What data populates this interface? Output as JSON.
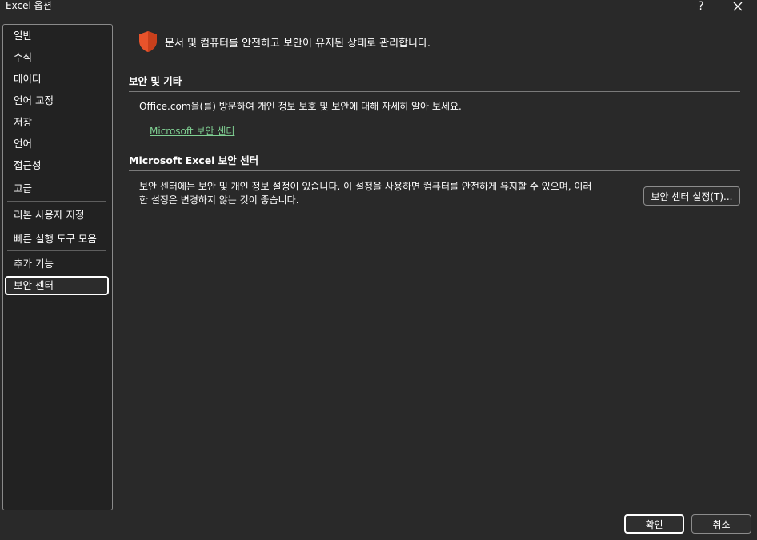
{
  "window": {
    "title": "Excel 옵션",
    "help_glyph": "?",
    "close_glyph": "✕"
  },
  "sidebar": {
    "items": [
      {
        "label": "일반"
      },
      {
        "label": "수식"
      },
      {
        "label": "데이터"
      },
      {
        "label": "언어 교정"
      },
      {
        "label": "저장"
      },
      {
        "label": "언어"
      },
      {
        "label": "접근성"
      },
      {
        "label": "고급"
      },
      {
        "label": "리본 사용자 지정"
      },
      {
        "label": "빠른 실행 도구 모음"
      },
      {
        "label": "추가 기능"
      },
      {
        "label": "보안 센터"
      }
    ],
    "selected": "보안 센터"
  },
  "main": {
    "header": "문서 및 컴퓨터를 안전하고 보안이 유지된 상태로 관리합니다.",
    "section1": {
      "title": "보안 및 기타",
      "text": "Office.com을(를) 방문하여 개인 정보 보호 및 보안에 대해 자세히 알아 보세요.",
      "link": "Microsoft 보안 센터"
    },
    "section2": {
      "title": "Microsoft Excel 보안 센터",
      "text_line1": "보안 센터에는 보안 및 개인 정보 설정이 있습니다. 이 설정을 사용하면 컴퓨터를 안전하게 유지할 수 있으며, 이러",
      "text_line2": "한 설정은 변경하지 않는 것이 좋습니다.",
      "button": "보안 센터 설정(T)..."
    }
  },
  "footer": {
    "ok": "확인",
    "cancel": "취소"
  },
  "colors": {
    "background": "#292929",
    "link": "#7fcf92",
    "shield": "#e8532b"
  },
  "icons": {
    "shield": "shield-icon"
  }
}
